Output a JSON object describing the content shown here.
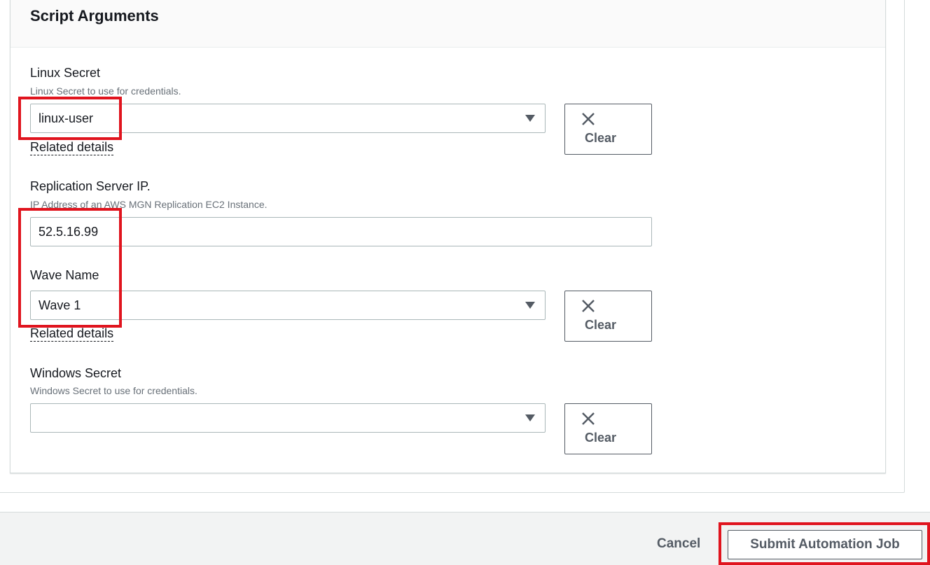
{
  "panel": {
    "title": "Script Arguments"
  },
  "fields": {
    "linux_secret": {
      "label": "Linux Secret",
      "description": "Linux Secret to use for credentials.",
      "value": "linux-user",
      "related": "Related details",
      "clear": "Clear"
    },
    "replication_ip": {
      "label": "Replication Server IP.",
      "description": "IP Address of an AWS MGN Replication EC2 Instance.",
      "value": "52.5.16.99"
    },
    "wave_name": {
      "label": "Wave Name",
      "value": "Wave 1",
      "related": "Related details",
      "clear": "Clear"
    },
    "windows_secret": {
      "label": "Windows Secret",
      "description": "Windows Secret to use for credentials.",
      "value": "",
      "clear": "Clear"
    }
  },
  "footer": {
    "cancel": "Cancel",
    "submit": "Submit Automation Job"
  },
  "colors": {
    "highlight": "#e0141e",
    "border": "#aab7b8",
    "button_text": "#545b64"
  },
  "icons": {
    "clear": "close-x-icon",
    "dropdown": "caret-down-icon"
  }
}
